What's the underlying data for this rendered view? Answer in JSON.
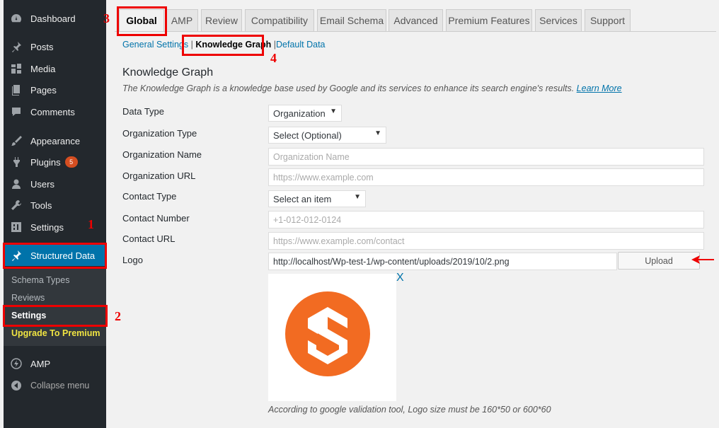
{
  "sidebar": {
    "items": [
      {
        "label": "Dashboard",
        "icon": "dashboard-icon"
      },
      {
        "label": "Posts",
        "icon": "pin-icon"
      },
      {
        "label": "Media",
        "icon": "media-icon"
      },
      {
        "label": "Pages",
        "icon": "pages-icon"
      },
      {
        "label": "Comments",
        "icon": "comment-icon"
      },
      {
        "label": "Appearance",
        "icon": "brush-icon"
      },
      {
        "label": "Plugins",
        "icon": "plugin-icon",
        "badge": "5"
      },
      {
        "label": "Users",
        "icon": "user-icon"
      },
      {
        "label": "Tools",
        "icon": "wrench-icon"
      },
      {
        "label": "Settings",
        "icon": "settings-icon"
      },
      {
        "label": "Structured Data",
        "icon": "pin-icon"
      },
      {
        "label": "AMP",
        "icon": "amp-icon"
      },
      {
        "label": "Collapse menu",
        "icon": "collapse-icon"
      }
    ],
    "submenu": [
      "Schema Types",
      "Reviews",
      "Settings",
      "Upgrade To Premium"
    ]
  },
  "annotations": {
    "n1": "1",
    "n2": "2",
    "n3": "3",
    "n4": "4"
  },
  "tabs": [
    "Global",
    "AMP",
    "Review",
    "Compatibility",
    "Email Schema",
    "Advanced",
    "Premium Features",
    "Services",
    "Support"
  ],
  "subnav": {
    "general": "General Settings",
    "knowledge": "Knowledge Graph",
    "default": "Default Data",
    "sep": "|"
  },
  "section": {
    "title": "Knowledge Graph",
    "description": "The Knowledge Graph is a knowledge base used by Google and its services to enhance its search engine's results.",
    "learn_more": "Learn More"
  },
  "fields": {
    "data_type": {
      "label": "Data Type",
      "value": "Organization"
    },
    "org_type": {
      "label": "Organization Type",
      "value": "Select (Optional)"
    },
    "org_name": {
      "label": "Organization Name",
      "placeholder": "Organization Name"
    },
    "org_url": {
      "label": "Organization URL",
      "placeholder": "https://www.example.com"
    },
    "contact_type": {
      "label": "Contact Type",
      "value": "Select an item"
    },
    "contact_number": {
      "label": "Contact Number",
      "placeholder": "+1-012-012-0124"
    },
    "contact_url": {
      "label": "Contact URL",
      "placeholder": "https://www.example.com/contact"
    },
    "logo": {
      "label": "Logo",
      "value": "http://localhost/Wp-test-1/wp-content/uploads/2019/10/2.png"
    }
  },
  "upload_label": "Upload",
  "remove_label": "X",
  "logo_note": "According to google validation tool, Logo size must be 160*50 or 600*60",
  "colors": {
    "accent": "#0073aa",
    "highlight": "#e00000",
    "logo_orange": "#f26b22"
  }
}
